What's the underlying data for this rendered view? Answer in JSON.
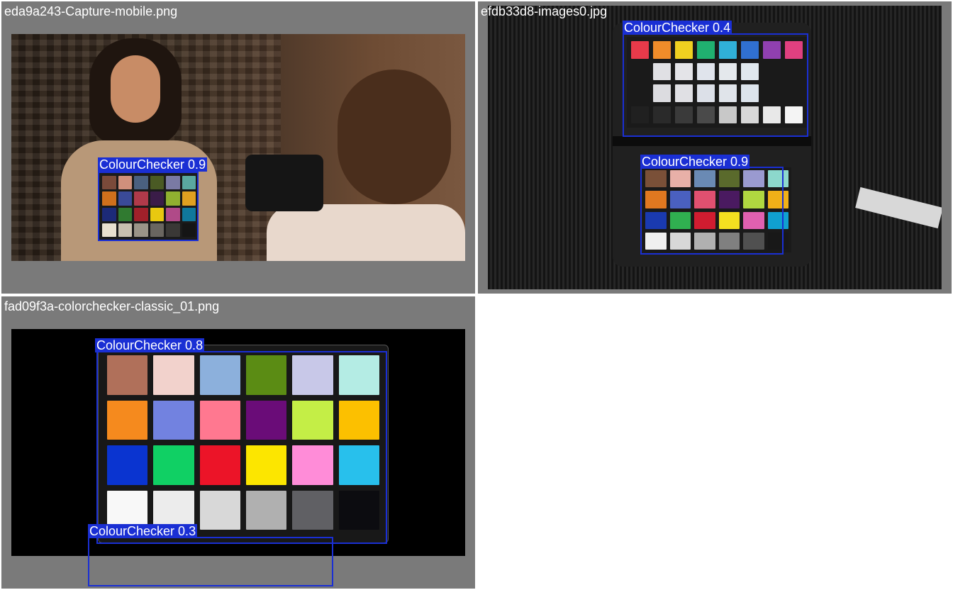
{
  "tiles": [
    {
      "filename": "eda9a243-Capture-mobile.png"
    },
    {
      "filename": "efdb33d8-images0.jpg"
    },
    {
      "filename": "fad09f3a-colorchecker-classic_01.png"
    }
  ],
  "detections": {
    "t1_a": {
      "label": "ColourChecker 0.9",
      "class": "ColourChecker",
      "confidence": 0.9
    },
    "t2_a": {
      "label": "ColourChecker 0.4",
      "class": "ColourChecker",
      "confidence": 0.4
    },
    "t2_b": {
      "label": "ColourChecker 0.9",
      "class": "ColourChecker",
      "confidence": 0.9
    },
    "t3_a": {
      "label": "ColourChecker 0.8",
      "class": "ColourChecker",
      "confidence": 0.8
    },
    "t3_b": {
      "label": "ColourChecker 0.3",
      "class": "ColourChecker",
      "confidence": 0.3
    }
  },
  "colors": {
    "box": "#1a2fd4",
    "tile_bg": "#7a7a7a",
    "classic_patches": [
      "#b0705a",
      "#f2d2cc",
      "#8cb0dc",
      "#5b8c14",
      "#c8c8e8",
      "#b4ece4",
      "#f58a1e",
      "#7282e0",
      "#ff7890",
      "#6a0c78",
      "#c4ee46",
      "#fcc000",
      "#0a34d0",
      "#10d064",
      "#ec1428",
      "#fce600",
      "#ff8cd8",
      "#28c0ec",
      "#f8f8f8",
      "#ececec",
      "#d8d8d8",
      "#b0b0b0",
      "#606064",
      "#0c0c10"
    ],
    "passport_top_row": [
      "#e83a4a",
      "#f08c2a",
      "#f0d020",
      "#20b070",
      "#30b0d8",
      "#3070d0",
      "#9040b0",
      "#e04080"
    ]
  }
}
